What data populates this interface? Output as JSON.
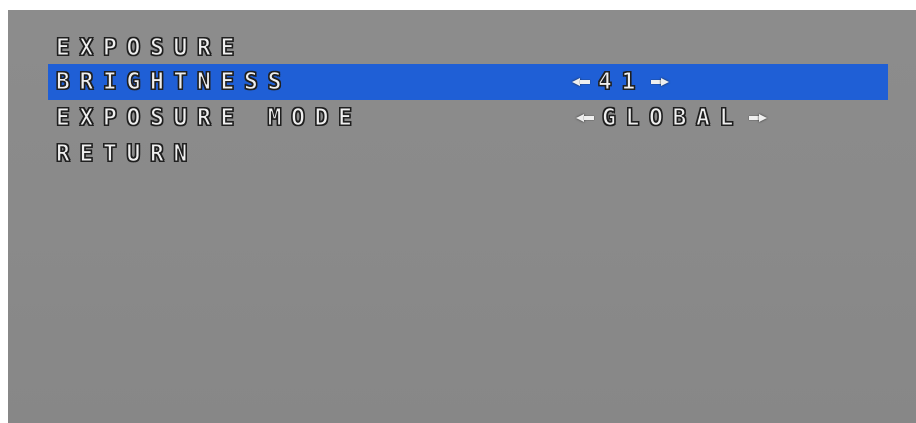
{
  "menu": {
    "title": "EXPOSURE",
    "items": [
      {
        "label": "BRIGHTNESS",
        "value": "41",
        "selected": true
      },
      {
        "label": "EXPOSURE MODE",
        "value": "GLOBAL",
        "selected": false
      },
      {
        "label": "RETURN",
        "value": "",
        "selected": false
      }
    ]
  },
  "colors": {
    "selection": "#1f5fd6",
    "background": "#8a8a8a",
    "text": "#efefef"
  },
  "icons": {
    "left_arrow": "arrow-left-icon",
    "right_arrow": "arrow-right-icon"
  }
}
